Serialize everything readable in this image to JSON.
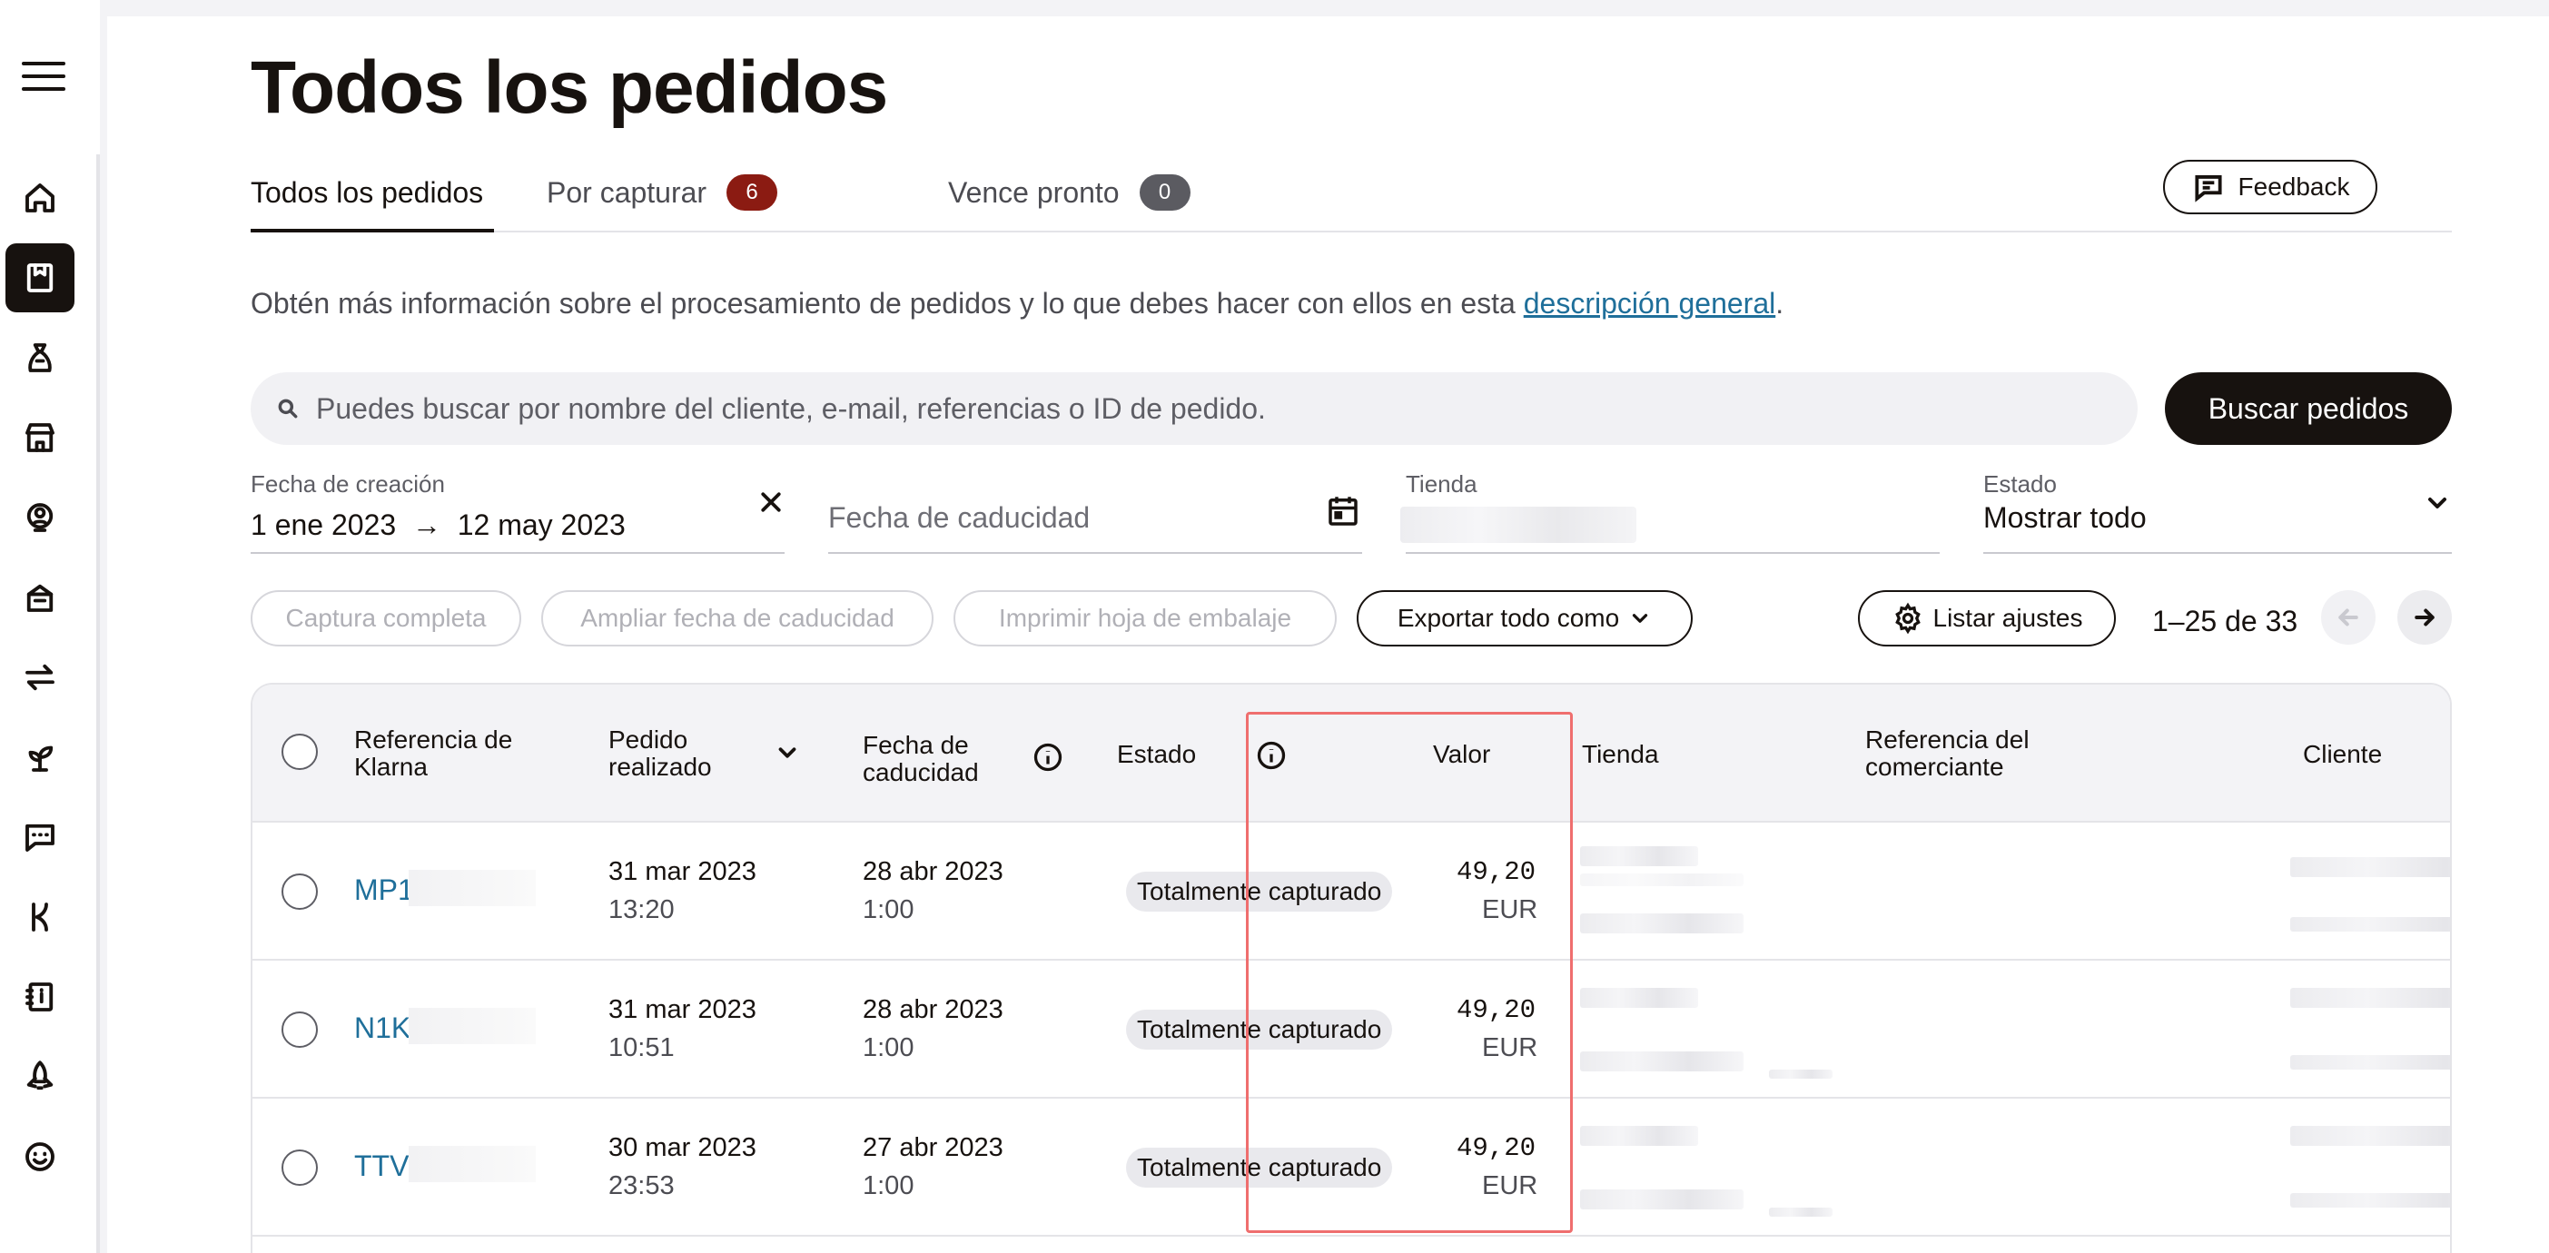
{
  "sidebar": {
    "menu_icon": "hamburger-menu-icon",
    "items": [
      {
        "icon": "home-icon",
        "active": false
      },
      {
        "icon": "orders-icon",
        "active": true
      },
      {
        "icon": "money-bag-icon",
        "active": false
      },
      {
        "icon": "store-icon",
        "active": false
      },
      {
        "icon": "customer-icon",
        "active": false
      },
      {
        "icon": "box-icon",
        "active": false
      },
      {
        "icon": "transfer-arrows-icon",
        "active": false
      },
      {
        "icon": "growth-plant-icon",
        "active": false
      },
      {
        "icon": "chat-icon",
        "active": false
      },
      {
        "icon": "klarna-k-icon",
        "active": false
      },
      {
        "icon": "guide-book-icon",
        "active": false
      },
      {
        "icon": "rocket-icon",
        "active": false
      },
      {
        "icon": "smiley-icon",
        "active": false
      }
    ]
  },
  "page": {
    "title": "Todos los pedidos"
  },
  "tabs": [
    {
      "label": "Todos los pedidos",
      "badge": null,
      "active": true
    },
    {
      "label": "Por capturar",
      "badge": "6",
      "badge_color": "#8b1b12",
      "active": false
    },
    {
      "label": "Vence pronto",
      "badge": "0",
      "badge_color": "#5b5b61",
      "active": false
    }
  ],
  "feedback_label": "Feedback",
  "info": {
    "text": "Obtén más información sobre el procesamiento de pedidos y lo que debes hacer con ellos en esta ",
    "link": "descripción general",
    "suffix": "."
  },
  "search": {
    "placeholder": "Puedes buscar por nombre del cliente, e-mail, referencias o ID de pedido.",
    "button": "Buscar pedidos"
  },
  "filters": {
    "creation_date": {
      "label": "Fecha de creación",
      "from": "1 ene 2023",
      "arrow": "→",
      "to": "12 may 2023"
    },
    "expiry_date": {
      "placeholder": "Fecha de caducidad"
    },
    "store": {
      "label": "Tienda"
    },
    "status": {
      "label": "Estado",
      "value": "Mostrar todo"
    }
  },
  "actions": {
    "capture": "Captura completa",
    "extend": "Ampliar fecha de caducidad",
    "print": "Imprimir hoja de embalaje",
    "export": "Exportar todo como",
    "list_settings": "Listar ajustes",
    "pagination": "1–25 de 33"
  },
  "table": {
    "headers": {
      "klarna_ref": "Referencia de Klarna",
      "placed": "Pedido realizado",
      "expiry": "Fecha de caducidad",
      "status": "Estado",
      "value": "Valor",
      "store": "Tienda",
      "merchant_ref": "Referencia del comerciante",
      "customer": "Cliente"
    },
    "rows": [
      {
        "ref": "MP1",
        "placed_date": "31 mar 2023",
        "placed_time": "13:20",
        "expiry_date": "28 abr 2023",
        "expiry_time": "1:00",
        "status": "Totalmente capturado",
        "amount": "49,20",
        "currency": "EUR"
      },
      {
        "ref": "N1K",
        "placed_date": "31 mar 2023",
        "placed_time": "10:51",
        "expiry_date": "28 abr 2023",
        "expiry_time": "1:00",
        "status": "Totalmente capturado",
        "amount": "49,20",
        "currency": "EUR"
      },
      {
        "ref": "TTV",
        "placed_date": "30 mar 2023",
        "placed_time": "23:53",
        "expiry_date": "27 abr 2023",
        "expiry_time": "1:00",
        "status": "Totalmente capturado",
        "amount": "49,20",
        "currency": "EUR"
      }
    ]
  },
  "colors": {
    "accent_link": "#1f6f9a",
    "highlight_box": "#ef6e6e",
    "primary_dark": "#17120f"
  }
}
